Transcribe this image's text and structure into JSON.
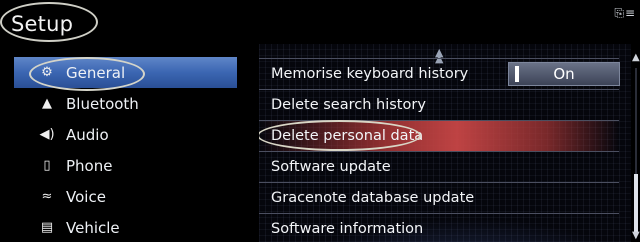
{
  "header": {
    "title": "Setup",
    "status_icons": "⎘≡"
  },
  "nav": {
    "items": [
      {
        "label": "General",
        "icon": "⚙"
      },
      {
        "label": "Bluetooth",
        "icon": "▲"
      },
      {
        "label": "Audio",
        "icon": "◀)"
      },
      {
        "label": "Phone",
        "icon": "▯"
      },
      {
        "label": "Voice",
        "icon": "≈"
      },
      {
        "label": "Vehicle",
        "icon": "▤"
      }
    ],
    "selected_index": 0
  },
  "list": {
    "items": [
      {
        "label": "Memorise keyboard history",
        "toggle": "On"
      },
      {
        "label": "Delete search history"
      },
      {
        "label": "Delete personal data"
      },
      {
        "label": "Software update"
      },
      {
        "label": "Gracenote database update"
      },
      {
        "label": "Software information"
      }
    ],
    "highlighted_index": 2
  },
  "scrollbar": {
    "up_icon": "▲",
    "down_icon": "▼"
  },
  "colors": {
    "selected_nav": "#3b66b2",
    "highlight_row": "#c84646",
    "toggle_bg": "#4f566b"
  }
}
